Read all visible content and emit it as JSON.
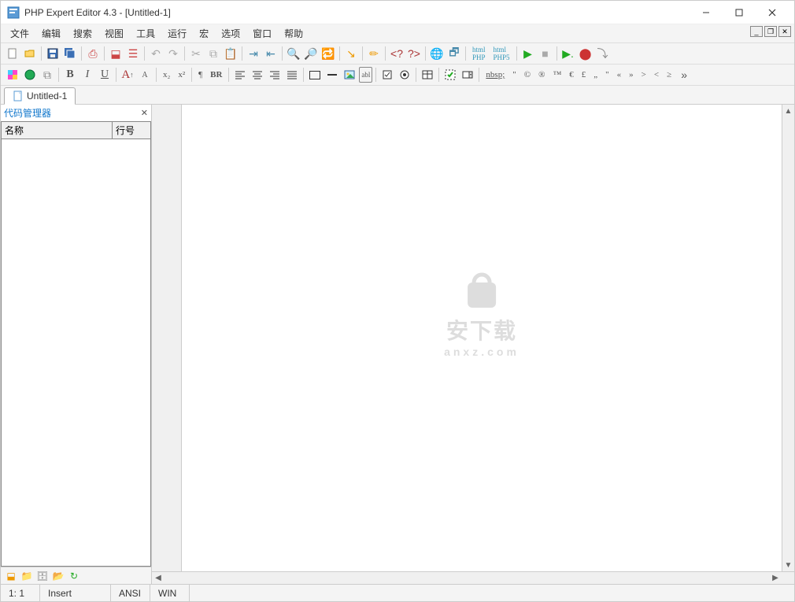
{
  "title": "PHP Expert Editor 4.3 - [Untitled-1]",
  "menubar": [
    "文件",
    "编辑",
    "搜索",
    "视图",
    "工具",
    "运行",
    "宏",
    "选项",
    "窗口",
    "帮助"
  ],
  "tabs": {
    "active": "Untitled-1"
  },
  "sidebar": {
    "title": "代码管理器",
    "col_name": "名称",
    "col_line": "行号"
  },
  "toolbar2": {
    "bold": "B",
    "italic": "I",
    "underline": "U",
    "font_a_big": "A",
    "font_a_small": "A",
    "sub": "x₂",
    "sup": "x²",
    "pilcrow": "¶",
    "br": "BR",
    "nbsp": "nbsp;",
    "entities": [
      "\"",
      "©",
      "®",
      "™",
      "€",
      "£",
      "„",
      "\"",
      "«",
      "»",
      ">",
      "<",
      "≥",
      "»"
    ]
  },
  "statusbar": {
    "pos": "1: 1",
    "mode": "Insert",
    "encoding": "ANSI",
    "eol": "WIN"
  },
  "watermark": {
    "main": "安下载",
    "sub": "anxz.com"
  }
}
